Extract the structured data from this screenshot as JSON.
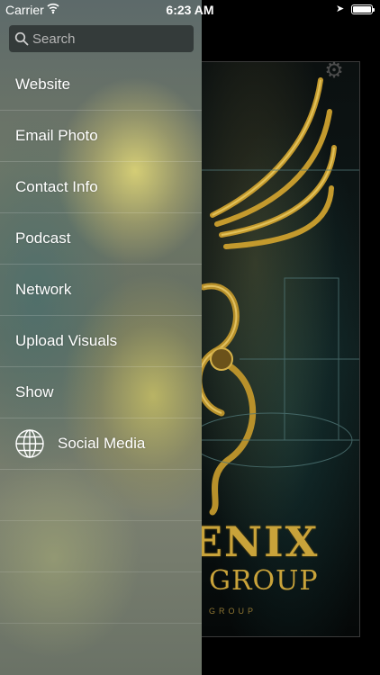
{
  "status_bar": {
    "carrier": "Carrier",
    "time": "6:23 AM",
    "battery_level": 1.0,
    "icons": [
      "wifi-icon",
      "location-arrow-icon",
      "battery-icon"
    ]
  },
  "search": {
    "placeholder": "Search",
    "value": ""
  },
  "menu": {
    "items": [
      {
        "label": "Website"
      },
      {
        "label": "Email Photo"
      },
      {
        "label": "Contact Info"
      },
      {
        "label": "Podcast"
      },
      {
        "label": "Network"
      },
      {
        "label": "Upload Visuals"
      },
      {
        "label": "Show"
      },
      {
        "label": "Social Media",
        "icon": "globe-icon"
      }
    ]
  },
  "background": {
    "title": "ENIX",
    "subtitle": "GROUP",
    "tagline": "GROUP",
    "settings_icon": "gear-icon",
    "accent_color": "#c9a33a"
  }
}
